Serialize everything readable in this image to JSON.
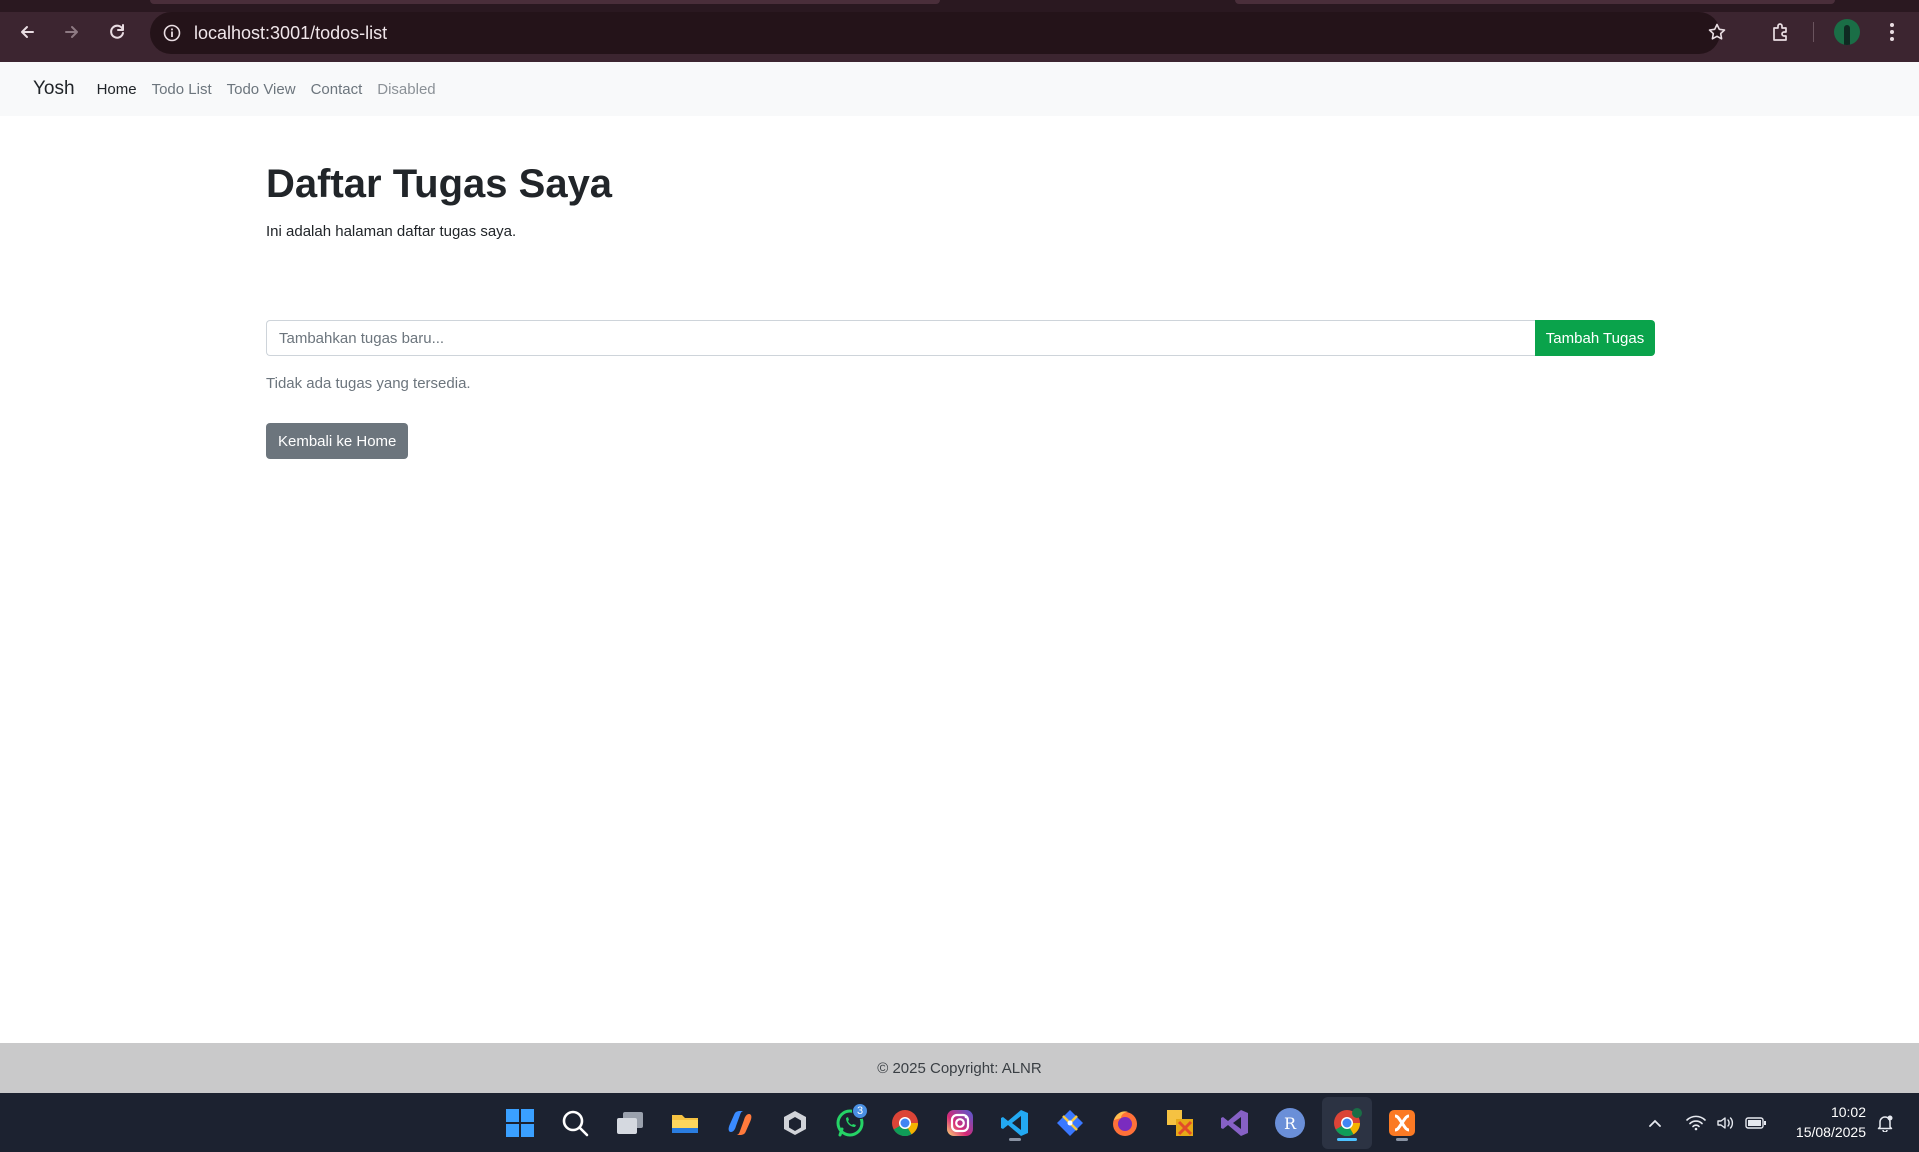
{
  "browser": {
    "url": "localhost:3001/todos-list",
    "icons": [
      "back-arrow-icon",
      "forward-arrow-icon",
      "reload-icon",
      "site-info-icon",
      "bookmark-star-icon",
      "extensions-icon",
      "profile-avatar",
      "more-menu-icon"
    ]
  },
  "navbar": {
    "brand": "Yosh",
    "links": [
      {
        "label": "Home",
        "state": "active"
      },
      {
        "label": "Todo List",
        "state": "normal"
      },
      {
        "label": "Todo View",
        "state": "normal"
      },
      {
        "label": "Contact",
        "state": "normal"
      },
      {
        "label": "Disabled",
        "state": "disabled"
      }
    ]
  },
  "main": {
    "title": "Daftar Tugas Saya",
    "subtitle": "Ini adalah halaman daftar tugas saya.",
    "task_input": {
      "value": "",
      "placeholder": "Tambahkan tugas baru..."
    },
    "add_button": "Tambah Tugas",
    "empty_message": "Tidak ada tugas yang tersedia.",
    "back_button": "Kembali ke Home"
  },
  "footer": {
    "text": "© 2025 Copyright: ALNR"
  },
  "taskbar": {
    "apps": [
      "windows-start",
      "search",
      "task-view",
      "file-explorer",
      "copilot",
      "unity",
      "whatsapp",
      "chrome",
      "instagram",
      "vscode",
      "git",
      "firefox",
      "xampp-tools",
      "visual-studio",
      "r-app",
      "chrome-active",
      "xampp"
    ],
    "whatsapp_badge": "3",
    "clock_time": "10:02",
    "clock_date": "15/08/2025"
  },
  "colors": {
    "accent_success": "#0aa34b",
    "secondary": "#6c757d",
    "browser_frame": "#3c2530",
    "taskbar": "#1c2230",
    "footer_bg": "#c9c9ca"
  }
}
